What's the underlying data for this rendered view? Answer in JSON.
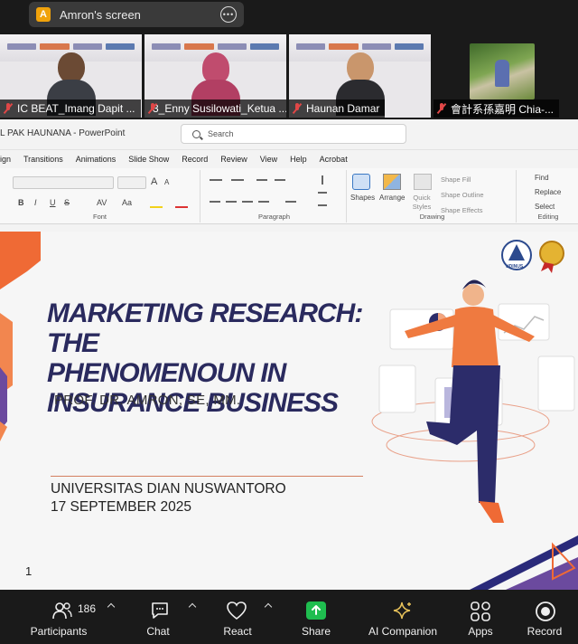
{
  "share_banner": {
    "initial": "A",
    "label": "Amron's screen",
    "more": "•••"
  },
  "participants": [
    {
      "name": "IC BEAT_Imang Dapit ..."
    },
    {
      "name": "3_Enny Susilowati_Ketua ..."
    },
    {
      "name": "Haunan Damar"
    },
    {
      "name": "會計系孫嘉明 Chia-..."
    }
  ],
  "powerpoint": {
    "doc_title": "L PAK HAUNANA  -  PowerPoint",
    "search_placeholder": "Search",
    "menu": [
      "ign",
      "Transitions",
      "Animations",
      "Slide Show",
      "Record",
      "Review",
      "View",
      "Help",
      "Acrobat"
    ],
    "ribbon": {
      "font_group": "Font",
      "paragraph_group": "Paragraph",
      "drawing_group": "Drawing",
      "editing_group": "Editing",
      "shapes": "Shapes",
      "arrange": "Arrange",
      "quick_styles": "Quick Styles",
      "shape_fill": "Shape Fill",
      "shape_outline": "Shape Outline",
      "shape_effects": "Shape Effects",
      "find": "Find",
      "replace": "Replace",
      "select": "Select",
      "bold": "B",
      "italic": "I",
      "underline": "U",
      "strike": "S",
      "font_a_large": "A",
      "font_a_small": "A",
      "av": "AV",
      "aa": "Aa"
    },
    "slide": {
      "title_line1": "MARKETING RESEARCH: THE",
      "title_line2": "PHENOMENOUN IN",
      "title_line3": "INSURANCE BUSINESS",
      "presenter": "PROF. DR. AMRON, SE, MM.",
      "university": "UNIVERSITAS DIAN NUSWANTORO",
      "date": "17 SEPTEMBER 2025",
      "page_number": "1",
      "logo_text": "UDINUS"
    }
  },
  "toolbar": {
    "participants_label": "Participants",
    "participants_count": "186",
    "chat_label": "Chat",
    "react_label": "React",
    "share_label": "Share",
    "ai_label": "AI Companion",
    "apps_label": "Apps",
    "record_label": "Record",
    "accent_share": "#1fbd4f"
  }
}
